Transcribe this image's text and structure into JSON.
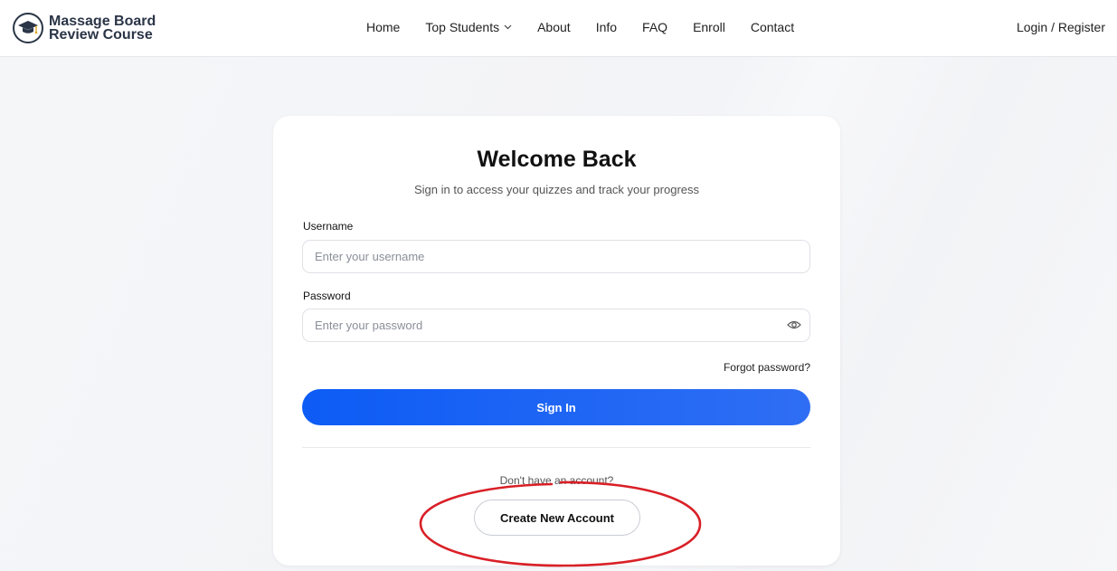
{
  "header": {
    "logo_line1": "Massage Board",
    "logo_line2": "Review Course",
    "logo_icon": "graduation-cap-icon",
    "nav": [
      {
        "label": "Home"
      },
      {
        "label": "Top Students",
        "has_dropdown": true
      },
      {
        "label": "About"
      },
      {
        "label": "Info"
      },
      {
        "label": "FAQ"
      },
      {
        "label": "Enroll"
      },
      {
        "label": "Contact"
      }
    ],
    "login_label": "Login / Register"
  },
  "card": {
    "title": "Welcome Back",
    "subtitle": "Sign in to access your quizzes and track your progress",
    "username_label": "Username",
    "username_placeholder": "Enter your username",
    "password_label": "Password",
    "password_placeholder": "Enter your password",
    "password_toggle_icon": "eye-icon",
    "forgot_label": "Forgot password?",
    "signin_label": "Sign In",
    "no_account_text": "Don't have an account?",
    "create_account_label": "Create New Account"
  },
  "colors": {
    "primary": "#0d5cf5",
    "brand": "#2a3547",
    "annotation": "#d92027"
  }
}
